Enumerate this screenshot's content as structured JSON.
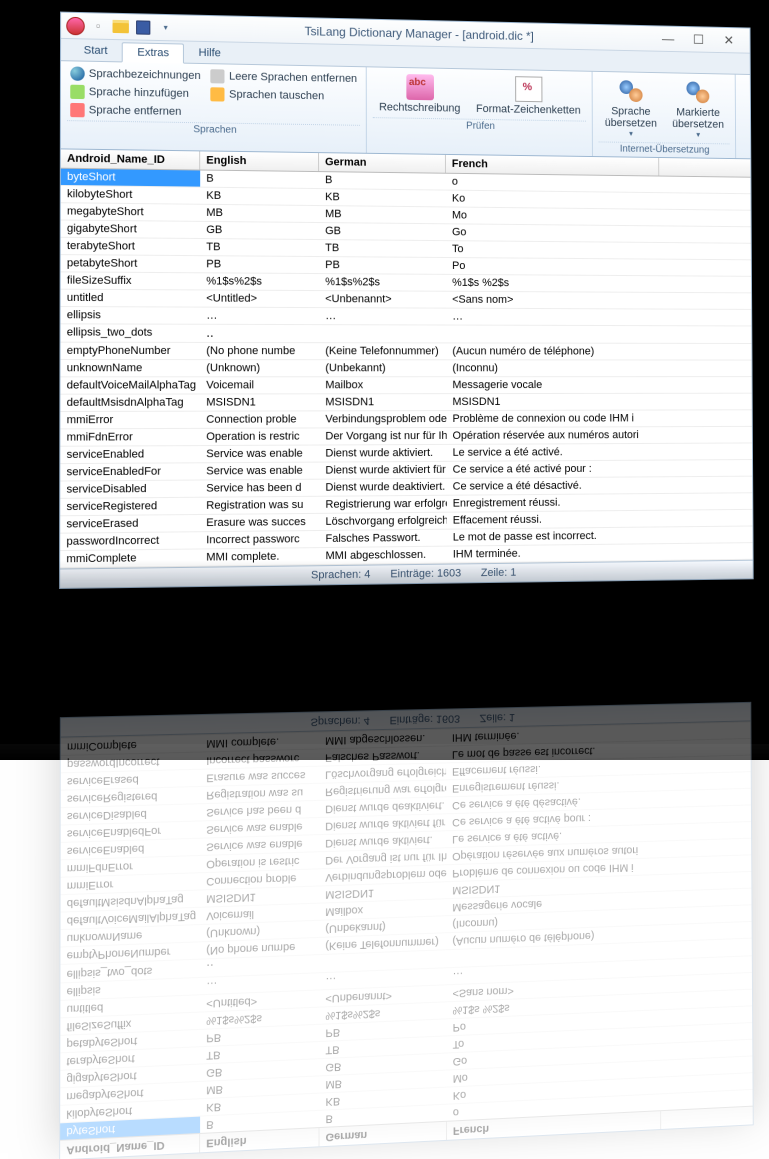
{
  "title": "TsiLang Dictionary Manager - [android.dic *]",
  "tabs": {
    "start": "Start",
    "extras": "Extras",
    "hilfe": "Hilfe"
  },
  "ribbon": {
    "sprachen": {
      "label": "Sprachen",
      "bezeichnungen": "Sprachbezeichnungen",
      "hinzufuegen": "Sprache hinzufügen",
      "entfernen": "Sprache entfernen",
      "leere": "Leere Sprachen entfernen",
      "tauschen": "Sprachen tauschen"
    },
    "pruefen": {
      "label": "Prüfen",
      "recht": "Rechtschreibung",
      "format": "Format-Zeichenketten"
    },
    "internet": {
      "label": "Internet-Übersetzung",
      "sprache": "Sprache\nübersetzen",
      "markierte": "Markierte\nübersetzen"
    }
  },
  "columns": {
    "id": "Android_Name_ID",
    "en": "English",
    "de": "German",
    "fr": "French"
  },
  "rows": [
    {
      "id": "byteShort",
      "en": "B",
      "de": "B",
      "fr": "o"
    },
    {
      "id": "kilobyteShort",
      "en": "KB",
      "de": "KB",
      "fr": "Ko"
    },
    {
      "id": "megabyteShort",
      "en": "MB",
      "de": "MB",
      "fr": "Mo"
    },
    {
      "id": "gigabyteShort",
      "en": "GB",
      "de": "GB",
      "fr": "Go"
    },
    {
      "id": "terabyteShort",
      "en": "TB",
      "de": "TB",
      "fr": "To"
    },
    {
      "id": "petabyteShort",
      "en": "PB",
      "de": "PB",
      "fr": "Po"
    },
    {
      "id": "fileSizeSuffix",
      "en": "%1$s%2$s",
      "de": "%1$s%2$s",
      "fr": "%1$s %2$s"
    },
    {
      "id": "untitled",
      "en": "<Untitled>",
      "de": "<Unbenannt>",
      "fr": "<Sans nom>"
    },
    {
      "id": "ellipsis",
      "en": "…",
      "de": "…",
      "fr": "…"
    },
    {
      "id": "ellipsis_two_dots",
      "en": "‥",
      "de": "",
      "fr": ""
    },
    {
      "id": "emptyPhoneNumber",
      "en": "(No phone numbe",
      "de": "(Keine Telefonnummer)",
      "fr": "(Aucun numéro de téléphone)"
    },
    {
      "id": "unknownName",
      "en": "(Unknown)",
      "de": "(Unbekannt)",
      "fr": "(Inconnu)"
    },
    {
      "id": "defaultVoiceMailAlphaTag",
      "en": "Voicemail",
      "de": "Mailbox",
      "fr": "Messagerie vocale"
    },
    {
      "id": "defaultMsisdnAlphaTag",
      "en": "MSISDN1",
      "de": "MSISDN1",
      "fr": "MSISDN1"
    },
    {
      "id": "mmiError",
      "en": "Connection proble",
      "de": "Verbindungsproblem oder ungülti",
      "fr": "Problème de connexion ou code IHM i"
    },
    {
      "id": "mmiFdnError",
      "en": "Operation is restric",
      "de": "Der Vorgang ist nur für Ihre zugela",
      "fr": "Opération réservée aux numéros autori"
    },
    {
      "id": "serviceEnabled",
      "en": "Service was enable",
      "de": "Dienst wurde aktiviert.",
      "fr": "Le service a été activé."
    },
    {
      "id": "serviceEnabledFor",
      "en": "Service was enable",
      "de": "Dienst wurde aktiviert für:",
      "fr": "Ce service a été activé pour :"
    },
    {
      "id": "serviceDisabled",
      "en": "Service has been d",
      "de": "Dienst wurde deaktiviert.",
      "fr": "Ce service a été désactivé."
    },
    {
      "id": "serviceRegistered",
      "en": "Registration was su",
      "de": "Registrierung war erfolgreich.",
      "fr": "Enregistrement réussi."
    },
    {
      "id": "serviceErased",
      "en": "Erasure was succes",
      "de": "Löschvorgang erfolgreich.",
      "fr": "Effacement réussi."
    },
    {
      "id": "passwordIncorrect",
      "en": "Incorrect passworc",
      "de": "Falsches Passwort.",
      "fr": "Le mot de passe est incorrect."
    },
    {
      "id": "mmiComplete",
      "en": "MMI complete.",
      "de": "MMI abgeschlossen.",
      "fr": "IHM terminée."
    }
  ],
  "status": {
    "sprachen": "Sprachen: 4",
    "eintraege": "Einträge: 1603",
    "zeile": "Zeile: 1"
  }
}
